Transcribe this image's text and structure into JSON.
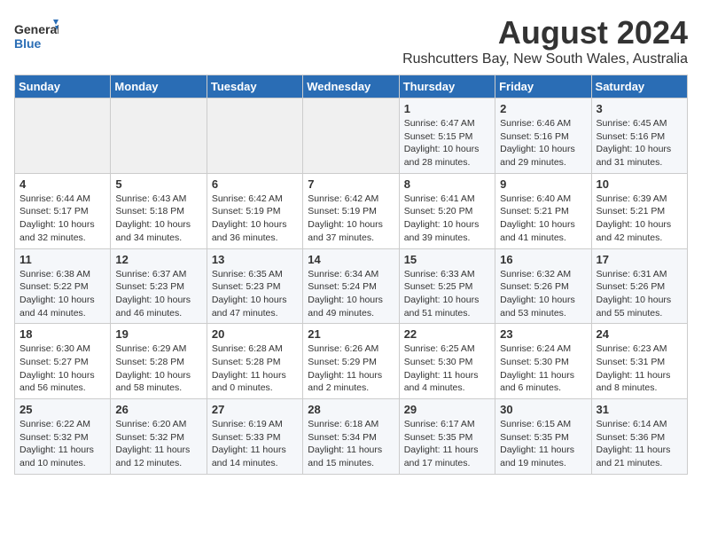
{
  "logo": {
    "general": "General",
    "blue": "Blue"
  },
  "title": "August 2024",
  "subtitle": "Rushcutters Bay, New South Wales, Australia",
  "weekdays": [
    "Sunday",
    "Monday",
    "Tuesday",
    "Wednesday",
    "Thursday",
    "Friday",
    "Saturday"
  ],
  "weeks": [
    [
      {
        "day": "",
        "info": ""
      },
      {
        "day": "",
        "info": ""
      },
      {
        "day": "",
        "info": ""
      },
      {
        "day": "",
        "info": ""
      },
      {
        "day": "1",
        "info": "Sunrise: 6:47 AM\nSunset: 5:15 PM\nDaylight: 10 hours\nand 28 minutes."
      },
      {
        "day": "2",
        "info": "Sunrise: 6:46 AM\nSunset: 5:16 PM\nDaylight: 10 hours\nand 29 minutes."
      },
      {
        "day": "3",
        "info": "Sunrise: 6:45 AM\nSunset: 5:16 PM\nDaylight: 10 hours\nand 31 minutes."
      }
    ],
    [
      {
        "day": "4",
        "info": "Sunrise: 6:44 AM\nSunset: 5:17 PM\nDaylight: 10 hours\nand 32 minutes."
      },
      {
        "day": "5",
        "info": "Sunrise: 6:43 AM\nSunset: 5:18 PM\nDaylight: 10 hours\nand 34 minutes."
      },
      {
        "day": "6",
        "info": "Sunrise: 6:42 AM\nSunset: 5:19 PM\nDaylight: 10 hours\nand 36 minutes."
      },
      {
        "day": "7",
        "info": "Sunrise: 6:42 AM\nSunset: 5:19 PM\nDaylight: 10 hours\nand 37 minutes."
      },
      {
        "day": "8",
        "info": "Sunrise: 6:41 AM\nSunset: 5:20 PM\nDaylight: 10 hours\nand 39 minutes."
      },
      {
        "day": "9",
        "info": "Sunrise: 6:40 AM\nSunset: 5:21 PM\nDaylight: 10 hours\nand 41 minutes."
      },
      {
        "day": "10",
        "info": "Sunrise: 6:39 AM\nSunset: 5:21 PM\nDaylight: 10 hours\nand 42 minutes."
      }
    ],
    [
      {
        "day": "11",
        "info": "Sunrise: 6:38 AM\nSunset: 5:22 PM\nDaylight: 10 hours\nand 44 minutes."
      },
      {
        "day": "12",
        "info": "Sunrise: 6:37 AM\nSunset: 5:23 PM\nDaylight: 10 hours\nand 46 minutes."
      },
      {
        "day": "13",
        "info": "Sunrise: 6:35 AM\nSunset: 5:23 PM\nDaylight: 10 hours\nand 47 minutes."
      },
      {
        "day": "14",
        "info": "Sunrise: 6:34 AM\nSunset: 5:24 PM\nDaylight: 10 hours\nand 49 minutes."
      },
      {
        "day": "15",
        "info": "Sunrise: 6:33 AM\nSunset: 5:25 PM\nDaylight: 10 hours\nand 51 minutes."
      },
      {
        "day": "16",
        "info": "Sunrise: 6:32 AM\nSunset: 5:26 PM\nDaylight: 10 hours\nand 53 minutes."
      },
      {
        "day": "17",
        "info": "Sunrise: 6:31 AM\nSunset: 5:26 PM\nDaylight: 10 hours\nand 55 minutes."
      }
    ],
    [
      {
        "day": "18",
        "info": "Sunrise: 6:30 AM\nSunset: 5:27 PM\nDaylight: 10 hours\nand 56 minutes."
      },
      {
        "day": "19",
        "info": "Sunrise: 6:29 AM\nSunset: 5:28 PM\nDaylight: 10 hours\nand 58 minutes."
      },
      {
        "day": "20",
        "info": "Sunrise: 6:28 AM\nSunset: 5:28 PM\nDaylight: 11 hours\nand 0 minutes."
      },
      {
        "day": "21",
        "info": "Sunrise: 6:26 AM\nSunset: 5:29 PM\nDaylight: 11 hours\nand 2 minutes."
      },
      {
        "day": "22",
        "info": "Sunrise: 6:25 AM\nSunset: 5:30 PM\nDaylight: 11 hours\nand 4 minutes."
      },
      {
        "day": "23",
        "info": "Sunrise: 6:24 AM\nSunset: 5:30 PM\nDaylight: 11 hours\nand 6 minutes."
      },
      {
        "day": "24",
        "info": "Sunrise: 6:23 AM\nSunset: 5:31 PM\nDaylight: 11 hours\nand 8 minutes."
      }
    ],
    [
      {
        "day": "25",
        "info": "Sunrise: 6:22 AM\nSunset: 5:32 PM\nDaylight: 11 hours\nand 10 minutes."
      },
      {
        "day": "26",
        "info": "Sunrise: 6:20 AM\nSunset: 5:32 PM\nDaylight: 11 hours\nand 12 minutes."
      },
      {
        "day": "27",
        "info": "Sunrise: 6:19 AM\nSunset: 5:33 PM\nDaylight: 11 hours\nand 14 minutes."
      },
      {
        "day": "28",
        "info": "Sunrise: 6:18 AM\nSunset: 5:34 PM\nDaylight: 11 hours\nand 15 minutes."
      },
      {
        "day": "29",
        "info": "Sunrise: 6:17 AM\nSunset: 5:35 PM\nDaylight: 11 hours\nand 17 minutes."
      },
      {
        "day": "30",
        "info": "Sunrise: 6:15 AM\nSunset: 5:35 PM\nDaylight: 11 hours\nand 19 minutes."
      },
      {
        "day": "31",
        "info": "Sunrise: 6:14 AM\nSunset: 5:36 PM\nDaylight: 11 hours\nand 21 minutes."
      }
    ]
  ]
}
